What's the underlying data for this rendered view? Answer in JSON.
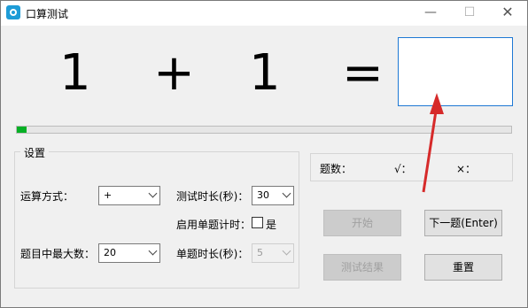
{
  "window": {
    "title": "口算测试",
    "minimize_glyph": "—",
    "maximize_glyph": "☐",
    "close_glyph": "✕"
  },
  "question": {
    "left_operand": "1",
    "operator": "+",
    "right_operand": "1",
    "equals": "=",
    "answer_value": ""
  },
  "progress": {
    "value_fraction": 0.02
  },
  "settings": {
    "group_title": "设置",
    "operation_label": "运算方式：",
    "operation_value": "+",
    "max_number_label": "题目中最大数：",
    "max_number_value": "20",
    "duration_label": "测试时长(秒)：",
    "duration_value": "30",
    "per_question_timer_label": "启用单题计时：",
    "per_question_timer_option": "是",
    "per_question_timer_checked": false,
    "per_question_duration_label": "单题时长(秒)：",
    "per_question_duration_value": "5"
  },
  "stats": {
    "count_label": "题数：",
    "correct_label": "√：",
    "wrong_label": "×："
  },
  "buttons": {
    "start": "开始",
    "next": "下一题(Enter)",
    "results": "测试结果",
    "reset": "重置"
  },
  "colors": {
    "accent_border": "#1e78d4",
    "progress_green": "#06b025",
    "annotation_red": "#d62a2a"
  }
}
